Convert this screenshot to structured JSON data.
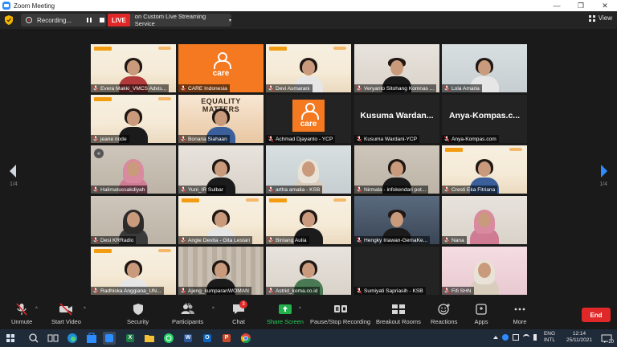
{
  "window": {
    "title": "Zoom Meeting",
    "controls": [
      "—",
      "❐",
      "✕"
    ]
  },
  "topbar": {
    "recording_label": "Recording...",
    "live_badge": "LIVE",
    "live_service": "on Custom Live Streaming Service",
    "live_caret": "▾",
    "view_label": "View"
  },
  "gallery": {
    "page_left": "1/4",
    "page_right": "1/4",
    "tiles": [
      {
        "name": "Evera Makki_VMCS Advis...",
        "kind": "banner-person"
      },
      {
        "name": "CARE Indonesia",
        "kind": "care-logo"
      },
      {
        "name": "Devi Asmarani",
        "kind": "banner-person"
      },
      {
        "name": "Veryanto Sitohang Komnas ...",
        "kind": "person"
      },
      {
        "name": "Lola Amaria",
        "kind": "person"
      },
      {
        "name": "jeane riode",
        "kind": "banner-person"
      },
      {
        "name": "Bonaria Siahaan",
        "kind": "poster",
        "poster_text": "EQUALITY MATTERS"
      },
      {
        "name": "Achmad Djayanto - YCP",
        "kind": "care-logo"
      },
      {
        "name": "Kusuma Wardani-YCP",
        "kind": "name-only",
        "display": "Kusuma  Wardan..."
      },
      {
        "name": "Anya-Kompas.com",
        "kind": "name-only",
        "display": "Anya-Kompas.c..."
      },
      {
        "name": "Halimatussakdiyah",
        "kind": "person",
        "badge": "«"
      },
      {
        "name": "Yuni_IR Sulbar",
        "kind": "person"
      },
      {
        "name": "artha amalia - KSB",
        "kind": "person"
      },
      {
        "name": "Nirmala - infokendari pot...",
        "kind": "person"
      },
      {
        "name": "Cresti Eka Fitriana",
        "kind": "banner-person"
      },
      {
        "name": "Desi KRRadio",
        "kind": "person"
      },
      {
        "name": "Angie Devita - Gita Lestari",
        "kind": "banner-person"
      },
      {
        "name": "Bintang Aulia",
        "kind": "banner-person"
      },
      {
        "name": "Hengky Iriawan-GemaKe...",
        "kind": "person"
      },
      {
        "name": "Nana",
        "kind": "person"
      },
      {
        "name": "Radhiska Anggiana_UN...",
        "kind": "banner-person"
      },
      {
        "name": "Ajeng_kumparanWOMAN",
        "kind": "person"
      },
      {
        "name": "Astrid_koma.co.id",
        "kind": "person"
      },
      {
        "name": "Sumiyati Sapriasih - KSB",
        "kind": "person"
      },
      {
        "name": "Fifi SHN",
        "kind": "person"
      }
    ]
  },
  "toolbar": {
    "unmute": "Unmute",
    "start_video": "Start Video",
    "security": "Security",
    "participants": "Participants",
    "participant_count": "89",
    "chat": "Chat",
    "chat_badge": "3",
    "share_screen": "Share Screen",
    "record": "Pause/Stop Recording",
    "breakout": "Breakout Rooms",
    "reactions": "Reactions",
    "apps": "Apps",
    "more": "More",
    "end": "End",
    "caret": "^"
  },
  "taskbar": {
    "lang_1": "ENG",
    "lang_2": "INTL",
    "time": "12:14",
    "date": "25/11/2021",
    "notifications": "20",
    "apps": [
      "search",
      "task-view",
      "edge",
      "store",
      "excel",
      "files",
      "whatsapp",
      "word",
      "outlook",
      "powerpoint",
      "chrome"
    ],
    "app_letters": {
      "excel": "X",
      "word": "W",
      "outlook": "O",
      "powerpoint": "P"
    }
  },
  "colors": {
    "accent_green": "#a6d34a",
    "live_red": "#e02828",
    "share_green": "#22b14c",
    "care_orange": "#f47920",
    "zoom_blue": "#2d8cff"
  }
}
